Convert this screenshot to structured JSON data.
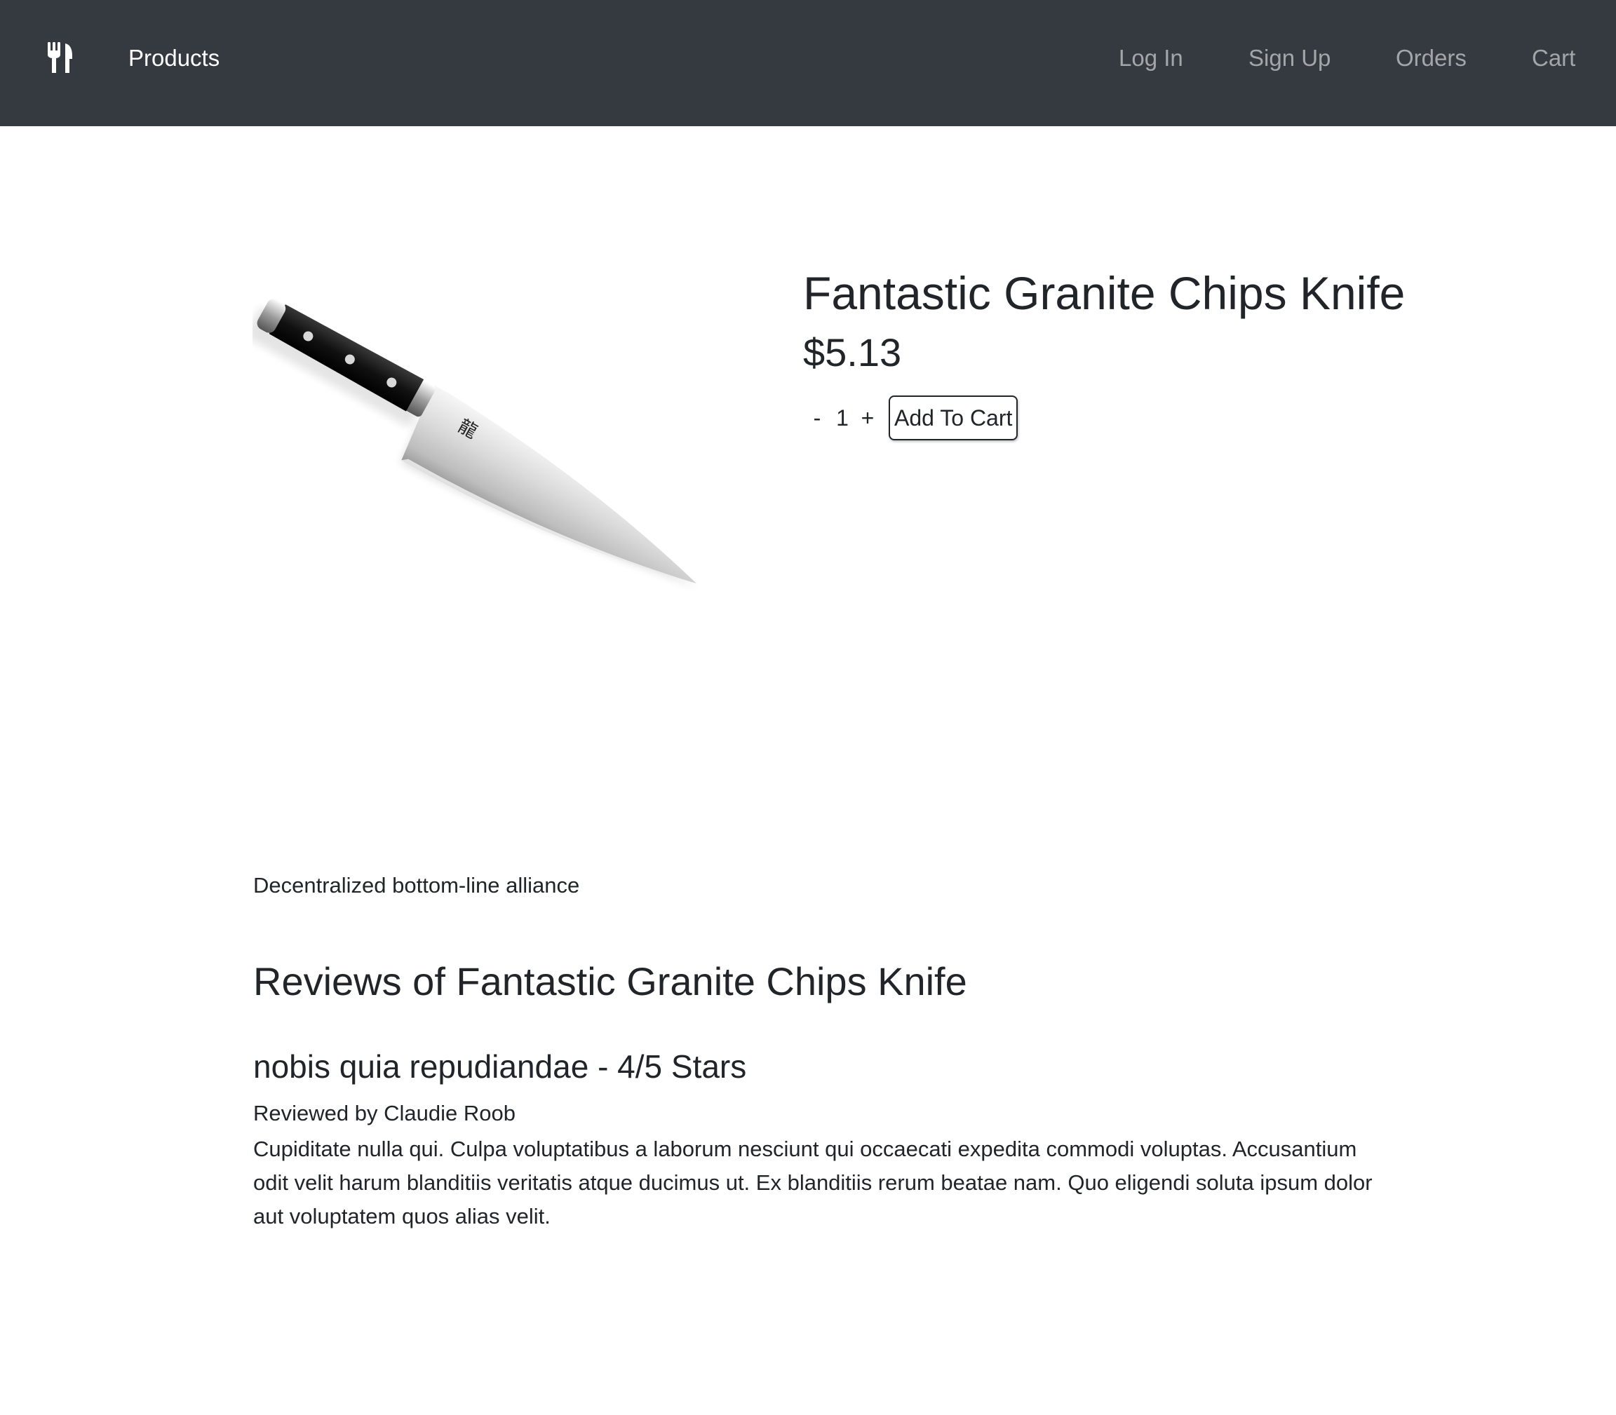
{
  "navbar": {
    "brand_icon": "fork-knife-icon",
    "products_label": "Products",
    "login_label": "Log In",
    "signup_label": "Sign Up",
    "orders_label": "Orders",
    "cart_label": "Cart",
    "background_color": "#343a40"
  },
  "product": {
    "title": "Fantastic Granite Chips Knife",
    "price": "$5.13",
    "quantity": "1",
    "decrement_label": "-",
    "increment_label": "+",
    "add_to_cart_label": "Add To Cart",
    "image_alt": "Chef's knife",
    "description": "Decentralized bottom-line alliance"
  },
  "reviews": {
    "heading": "Reviews of Fantastic Granite Chips Knife",
    "items": [
      {
        "title": "nobis quia repudiandae - 4/5 Stars",
        "author": "Reviewed by Claudie Roob",
        "body": "Cupiditate nulla qui. Culpa voluptatibus a laborum nesciunt qui occaecati expedita commodi voluptas. Accusantium odit velit harum blanditiis veritatis atque ducimus ut. Ex blanditiis rerum beatae nam. Quo eligendi soluta ipsum dolor aut voluptatem quos alias velit."
      }
    ]
  }
}
